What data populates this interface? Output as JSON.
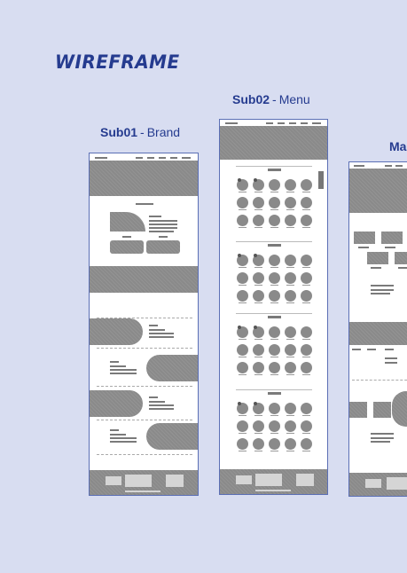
{
  "title": "WIREFRAME",
  "captions": [
    {
      "code": "Sub01",
      "sep": "-",
      "name": "Brand"
    },
    {
      "code": "Sub02",
      "sep": "-",
      "name": "Menu"
    },
    {
      "code": "Ma",
      "sep": "",
      "name": ""
    }
  ]
}
